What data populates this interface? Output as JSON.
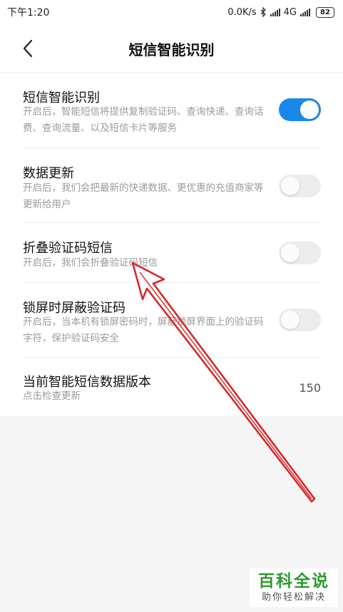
{
  "status_bar": {
    "time": "下午1:20",
    "network_speed": "0.0K/s",
    "network_type": "4G",
    "battery": "82",
    "icons": [
      "bluetooth-icon",
      "signal-icon",
      "battery-icon"
    ]
  },
  "header": {
    "title": "短信智能识别",
    "back_icon": "chevron-left-icon"
  },
  "settings": [
    {
      "title": "短信智能识别",
      "description": "开启后，智能短信将提供复制验证码、查询快递、查询话费、查询流量、以及短信卡片等服务",
      "enabled": true
    },
    {
      "title": "数据更新",
      "description": "开启后，我们会把最新的快递数据、更优惠的充值商家等更新给用户",
      "enabled": false
    },
    {
      "title": "折叠验证码短信",
      "description": "开启后，我们会折叠验证码短信",
      "enabled": false
    },
    {
      "title": "锁屏时屏蔽验证码",
      "description": "开启后，当本机有锁屏密码时，屏蔽锁屏界面上的验证码字符，保护验证码安全",
      "enabled": false
    }
  ],
  "version_row": {
    "title": "当前智能短信数据版本",
    "subtitle": "点击检查更新",
    "value": "150"
  },
  "colors": {
    "toggle_on": "#1a88e8",
    "toggle_off": "#ececec",
    "annotation_arrow": "#d42a2a",
    "watermark_green": "#2e9a2e"
  },
  "watermark": {
    "main": "百科全说",
    "sub": "助你轻松解决"
  }
}
